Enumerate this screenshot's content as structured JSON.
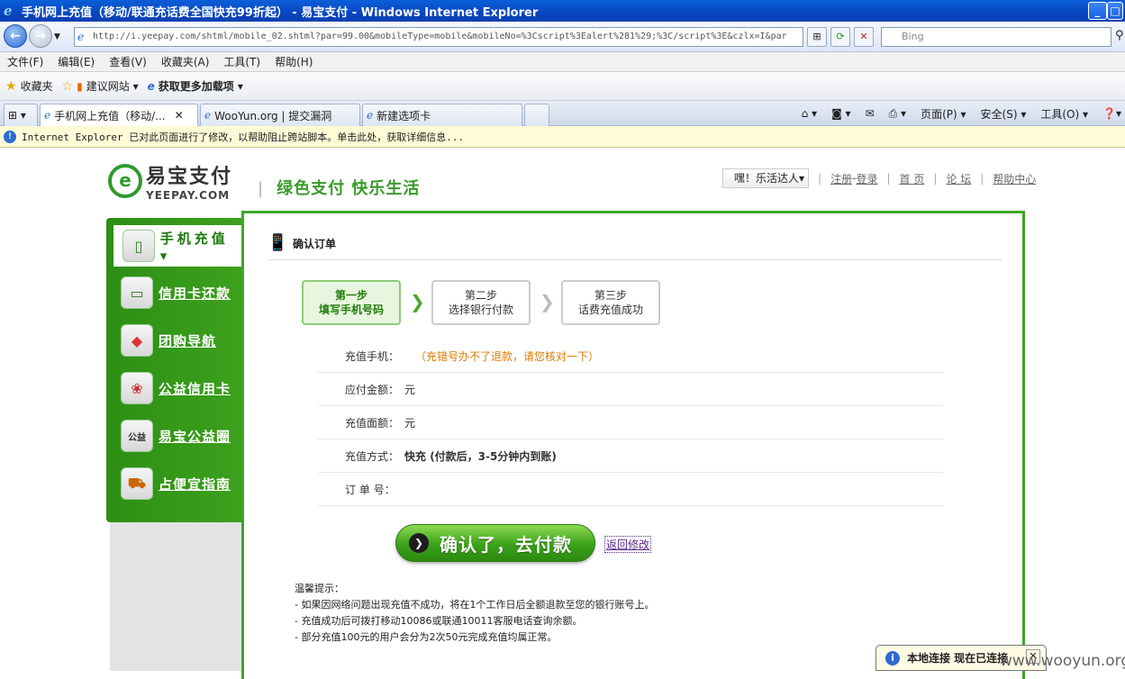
{
  "window": {
    "title": "手机网上充值（移动/联通充话费全国快充99折起） - 易宝支付 - Windows Internet Explorer",
    "min": "_",
    "max": "□",
    "close": "✕"
  },
  "address": {
    "url": "http://i.yeepay.com/shtml/mobile_02.shtml?par=99.00&mobileType=mobile&mobileNo=%3Cscript%3Ealert%281%29;%3C/script%3E&czlx=I&par",
    "search_placeholder": "Bing"
  },
  "menu": [
    "文件(F)",
    "编辑(E)",
    "查看(V)",
    "收藏夹(A)",
    "工具(T)",
    "帮助(H)"
  ],
  "favorites": {
    "fav_label": "收藏夹",
    "suggest": "建议网站 ▾",
    "addons": "获取更多加载项 ▾"
  },
  "tabs": [
    {
      "label": "手机网上充值（移动/..."
    },
    {
      "label": "WooYun.org | 提交漏洞"
    },
    {
      "label": "新建选项卡"
    }
  ],
  "commands": {
    "page": "页面(P) ▾",
    "safety": "安全(S) ▾",
    "tools": "工具(O) ▾"
  },
  "infobar": "Internet Explorer 已对此页面进行了修改，以帮助阻止跨站脚本。单击此处，获取详细信息...",
  "site": {
    "logo_cn": "易宝支付",
    "logo_en": "YEEPAY.COM",
    "slogan": "绿色支付  快乐生活",
    "user": "嘿！乐活达人▾",
    "nav": [
      "注册",
      "登录",
      "首 页",
      "论 坛",
      "帮助中心"
    ]
  },
  "sidebar": [
    {
      "label": "手机充值 ▾",
      "icon": "phone-icon"
    },
    {
      "label": "信用卡还款",
      "icon": "credit-card-icon"
    },
    {
      "label": "团购导航",
      "icon": "group-buy-icon"
    },
    {
      "label": "公益信用卡",
      "icon": "charity-card-icon"
    },
    {
      "label": "易宝公益圈",
      "icon": "charity-circle-icon"
    },
    {
      "label": "占便宜指南",
      "icon": "shopping-cart-icon"
    }
  ],
  "order": {
    "header": "确认订单",
    "steps": [
      {
        "num": "第一步",
        "name": "填写手机号码"
      },
      {
        "num": "第二步",
        "name": "选择银行付款"
      },
      {
        "num": "第三步",
        "name": "话费充值成功"
      }
    ],
    "rows": [
      {
        "label": "充值手机：",
        "value": "",
        "note": "（充错号办不了退款，请您核对一下）"
      },
      {
        "label": "应付金额：",
        "value": "元"
      },
      {
        "label": "充值面额：",
        "value": "元"
      },
      {
        "label": "充值方式：",
        "value": "快充 (付款后，3-5分钟内到账)"
      },
      {
        "label": "订 单 号：",
        "value": ""
      }
    ],
    "pay_button": "确认了，去付款",
    "back_link": "返回修改",
    "tips_title": "温馨提示：",
    "tips": [
      "- 如果因网络问题出现充值不成功，将在1个工作日后全额退款至您的银行账号上。",
      "- 充值成功后可拨打移动10086或联通10011客服电话查询余额。",
      "- 部分充值100元的用户会分为2次50元完成充值均属正常。"
    ]
  },
  "popup": "本地连接  现在已连接",
  "watermark": "www.wooyun.org"
}
